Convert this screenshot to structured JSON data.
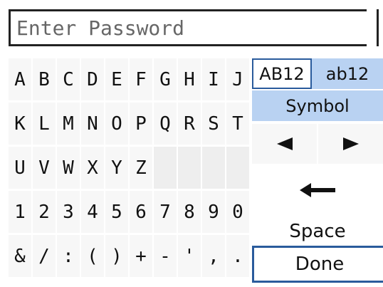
{
  "input": {
    "placeholder": "Enter Password"
  },
  "keyboard": {
    "rows": [
      [
        "A",
        "B",
        "C",
        "D",
        "E",
        "F",
        "G",
        "H",
        "I",
        "J"
      ],
      [
        "K",
        "L",
        "M",
        "N",
        "O",
        "P",
        "Q",
        "R",
        "S",
        "T"
      ],
      [
        "U",
        "V",
        "W",
        "X",
        "Y",
        "Z",
        "",
        "",
        "",
        ""
      ],
      [
        "1",
        "2",
        "3",
        "4",
        "5",
        "6",
        "7",
        "8",
        "9",
        "0"
      ],
      [
        "&",
        "/",
        ":",
        "(",
        ")",
        "+",
        "-",
        "'",
        ",",
        "."
      ]
    ]
  },
  "modes": {
    "upper": "AB12",
    "lower": "ab12",
    "symbol": "Symbol"
  },
  "actions": {
    "space": "Space",
    "done": "Done"
  },
  "icons": {
    "left": "left-arrow-icon",
    "right": "right-arrow-icon",
    "backspace": "backspace-arrow-icon"
  },
  "colors": {
    "accent": "#2a5b9c",
    "mode_bg": "#b9d2f2"
  }
}
